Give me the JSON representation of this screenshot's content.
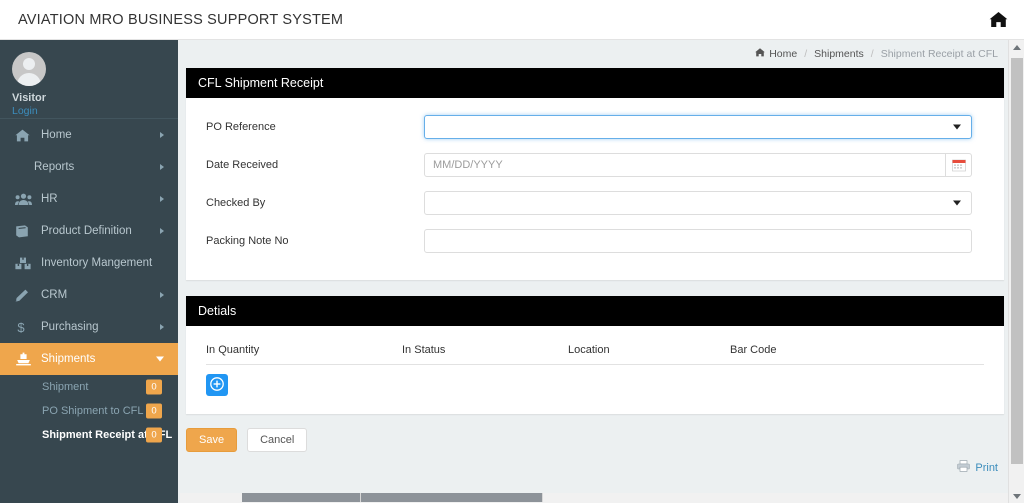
{
  "topbar": {
    "brand": "AVIATION MRO BUSINESS SUPPORT SYSTEM",
    "home_icon": "home-icon"
  },
  "sidebar": {
    "user": {
      "name": "Visitor",
      "login_label": "Login",
      "avatar_icon": "user-avatar-icon"
    },
    "items": [
      {
        "label": "Home",
        "icon": "home-icon",
        "caret": true,
        "active": false
      },
      {
        "label": "Reports",
        "icon": "",
        "caret": true,
        "active": false
      },
      {
        "label": "HR",
        "icon": "users-icon",
        "caret": true,
        "active": false
      },
      {
        "label": "Product Definition",
        "icon": "book-icon",
        "caret": true,
        "active": false
      },
      {
        "label": "Inventory Mangement",
        "icon": "boxes-icon",
        "caret": false,
        "active": false
      },
      {
        "label": "CRM",
        "icon": "pencil-icon",
        "caret": true,
        "active": false
      },
      {
        "label": "Purchasing",
        "icon": "dollar-icon",
        "caret": true,
        "active": false
      },
      {
        "label": "Shipments",
        "icon": "ship-icon",
        "caret": true,
        "active": true
      }
    ],
    "subitems": [
      {
        "label": "Shipment",
        "badge": "0",
        "current": false
      },
      {
        "label": "PO Shipment to CFL",
        "badge": "0",
        "current": false
      },
      {
        "label": "Shipment Receipt at CFL",
        "badge": "0",
        "current": true
      }
    ]
  },
  "breadcrumb": {
    "home": "Home",
    "level2": "Shipments",
    "current": "Shipment Receipt at CFL",
    "separator": "/",
    "home_icon": "home-icon"
  },
  "form_panel": {
    "title": "CFL Shipment Receipt",
    "fields": {
      "po_reference": {
        "label": "PO Reference",
        "value": "",
        "placeholder": "",
        "type": "select"
      },
      "date_received": {
        "label": "Date Received",
        "value": "",
        "placeholder": "MM/DD/YYYY",
        "type": "date",
        "icon": "calendar-icon"
      },
      "checked_by": {
        "label": "Checked By",
        "value": "",
        "placeholder": "",
        "type": "select"
      },
      "packing_note_no": {
        "label": "Packing Note No",
        "value": "",
        "placeholder": "",
        "type": "text"
      }
    }
  },
  "details_panel": {
    "title": "Detials",
    "columns": [
      "In Quantity",
      "In Status",
      "Location",
      "Bar Code"
    ],
    "rows": [],
    "add_button": {
      "icon": "plus-circle-icon",
      "color": "#2196f3"
    }
  },
  "actions": {
    "save_label": "Save",
    "cancel_label": "Cancel",
    "save_color": "#efa64c"
  },
  "footer": {
    "print_label": "Print",
    "print_icon": "printer-icon"
  },
  "colors": {
    "sidebar_bg": "#37474f",
    "accent": "#efa64c",
    "panel_header_bg": "#000000",
    "content_bg": "#ecf0f1",
    "link": "#3c8dbc"
  }
}
